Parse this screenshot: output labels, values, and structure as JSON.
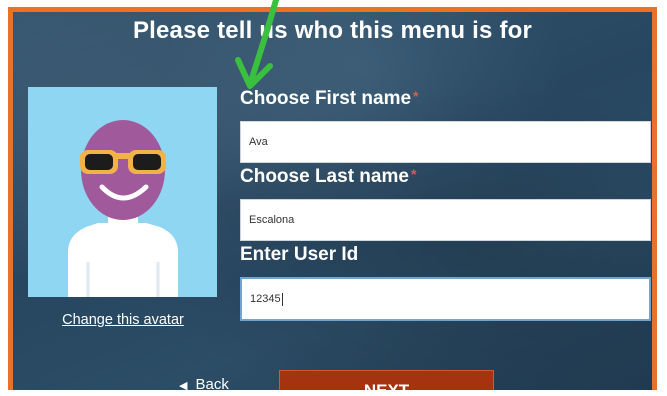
{
  "page": {
    "title": "Please tell us who this menu is for"
  },
  "avatar": {
    "change_link": "Change this avatar"
  },
  "form": {
    "first_name_label": "Choose First name",
    "first_name_required": "*",
    "first_name_value": "Ava",
    "last_name_label": "Choose Last name",
    "last_name_required": "*",
    "last_name_value": "Escalona",
    "user_id_label": "Enter User Id",
    "user_id_value": "12345"
  },
  "nav": {
    "back_label": "Back",
    "back_icon": "triangle-left-icon",
    "next_label": "NEXT"
  },
  "colors": {
    "frame_border": "#e8722a",
    "background": "#2c4d66",
    "next_button": "#a6330f",
    "avatar_bg": "#8fd6f2",
    "arrow": "#3bbf3f",
    "required": "#e05a4a"
  }
}
